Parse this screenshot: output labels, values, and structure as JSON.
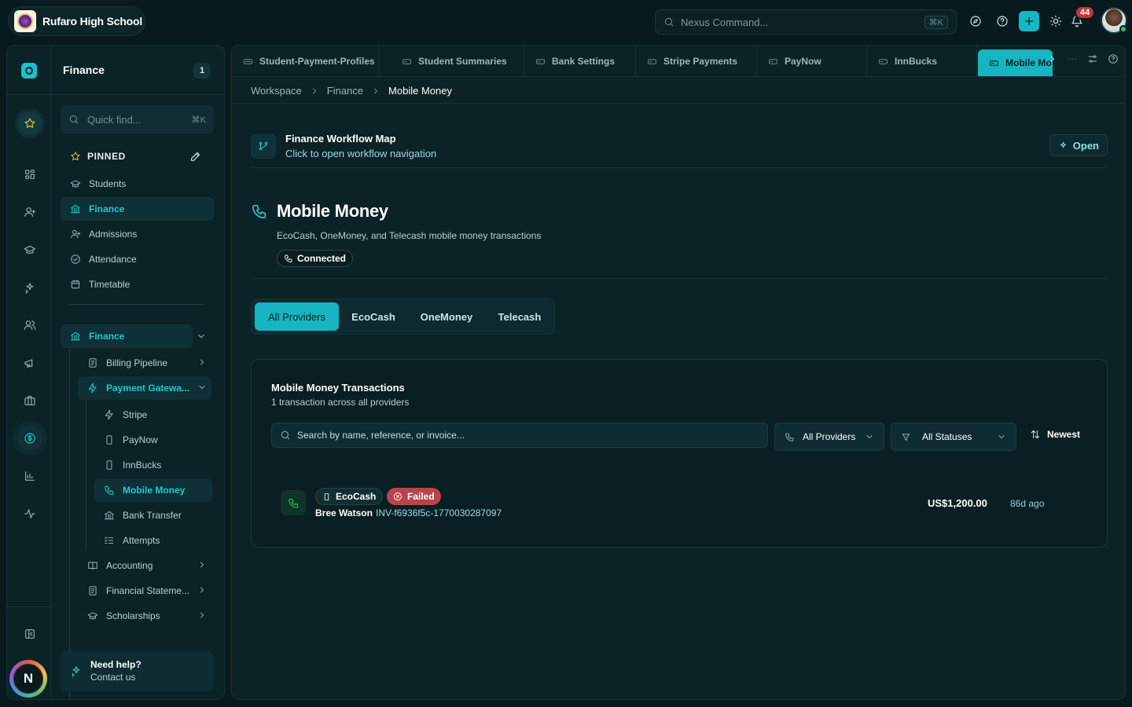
{
  "school": {
    "name": "Rufaro High School"
  },
  "command": {
    "placeholder": "Nexus Command...",
    "shortcut": "⌘K"
  },
  "notifications": {
    "count": "44"
  },
  "user": {
    "initial": "N"
  },
  "sidebar": {
    "title": "Finance",
    "count": "1",
    "quick_find": {
      "placeholder": "Quick find...",
      "shortcut": "⌘K"
    },
    "pinned_label": "PINNED",
    "pinned": [
      {
        "label": "Students",
        "icon": "graduation-cap-icon"
      },
      {
        "label": "Finance",
        "icon": "bank-icon"
      },
      {
        "label": "Admissions",
        "icon": "user-plus-icon"
      },
      {
        "label": "Attendance",
        "icon": "check-circle-icon"
      },
      {
        "label": "Timetable",
        "icon": "calendar-icon"
      }
    ],
    "group": {
      "label": "Finance",
      "items": [
        {
          "label": "Billing Pipeline"
        },
        {
          "label": "Payment Gatewa..."
        },
        {
          "label": "Stripe"
        },
        {
          "label": "PayNow"
        },
        {
          "label": "InnBucks"
        },
        {
          "label": "Mobile Money"
        },
        {
          "label": "Bank Transfer"
        },
        {
          "label": "Attempts"
        },
        {
          "label": "Accounting"
        },
        {
          "label": "Financial Stateme..."
        },
        {
          "label": "Scholarships"
        }
      ]
    },
    "help": {
      "title": "Need help?",
      "subtitle": "Contact us"
    }
  },
  "tabs": [
    {
      "label": "Student-Payment-Profiles"
    },
    {
      "label": "Student Summaries"
    },
    {
      "label": "Bank Settings"
    },
    {
      "label": "Stripe Payments"
    },
    {
      "label": "PayNow"
    },
    {
      "label": "InnBucks"
    },
    {
      "label": "Mobile Mo"
    }
  ],
  "breadcrumb": [
    "Workspace",
    "Finance",
    "Mobile Money"
  ],
  "workflow": {
    "title": "Finance Workflow Map",
    "subtitle": "Click to open workflow navigation",
    "open_label": "Open"
  },
  "page": {
    "title": "Mobile Money",
    "subtitle": "EcoCash, OneMoney, and Telecash mobile money transactions",
    "status": "Connected"
  },
  "providers": [
    "All Providers",
    "EcoCash",
    "OneMoney",
    "Telecash"
  ],
  "transactions": {
    "title": "Mobile Money Transactions",
    "subtitle": "1 transaction across all providers",
    "search_placeholder": "Search by name, reference, or invoice...",
    "provider_filter": "All Providers",
    "status_filter": "All Statuses",
    "sort": "Newest",
    "rows": [
      {
        "provider": "EcoCash",
        "status": "Failed",
        "name": "Bree Watson",
        "ref": "INV-f6936f5c-1770030287097",
        "amount": "US$1,200.00",
        "age": "86d ago"
      }
    ]
  },
  "colors": {
    "accent": "#17b4c1",
    "failed": "#b8444b",
    "star": "#e2b93b",
    "success": "#22c55e"
  }
}
